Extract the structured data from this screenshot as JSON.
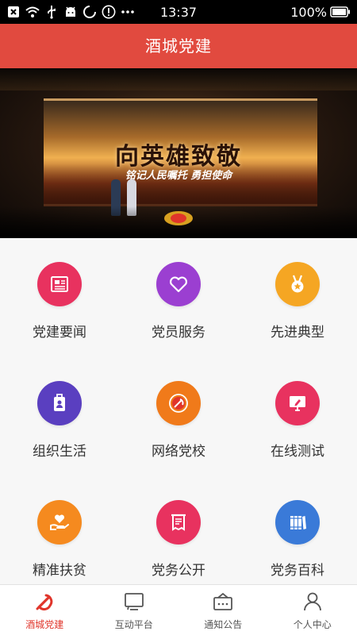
{
  "status_bar": {
    "time": "13:37",
    "battery": "100%"
  },
  "header": {
    "title": "酒城党建"
  },
  "banner": {
    "title": "向英雄致敬",
    "subtitle": "铭记人民嘱托 勇担使命"
  },
  "grid": {
    "items": [
      {
        "label": "党建要闻",
        "icon": "newspaper-icon",
        "color": "#e8325f"
      },
      {
        "label": "党员服务",
        "icon": "heart-icon",
        "color": "#9b3fd1"
      },
      {
        "label": "先进典型",
        "icon": "medal-icon",
        "color": "#f5a623"
      },
      {
        "label": "组织生活",
        "icon": "id-badge-icon",
        "color": "#5a3fc0"
      },
      {
        "label": "网络党校",
        "icon": "party-emblem-icon",
        "color": "#f07a1a"
      },
      {
        "label": "在线测试",
        "icon": "monitor-icon",
        "color": "#e8325f"
      },
      {
        "label": "精准扶贫",
        "icon": "hand-heart-icon",
        "color": "#f58a1f"
      },
      {
        "label": "党务公开",
        "icon": "receipt-icon",
        "color": "#e8325f"
      },
      {
        "label": "党务百科",
        "icon": "books-icon",
        "color": "#3a7ad8"
      }
    ]
  },
  "tabbar": {
    "items": [
      {
        "label": "酒城党建",
        "icon": "party-emblem-icon",
        "active": true
      },
      {
        "label": "互动平台",
        "icon": "chat-icon",
        "active": false
      },
      {
        "label": "通知公告",
        "icon": "notice-icon",
        "active": false
      },
      {
        "label": "个人中心",
        "icon": "user-icon",
        "active": false
      }
    ]
  },
  "colors": {
    "header": "#e14a3f",
    "active_tab": "#e0352b"
  }
}
